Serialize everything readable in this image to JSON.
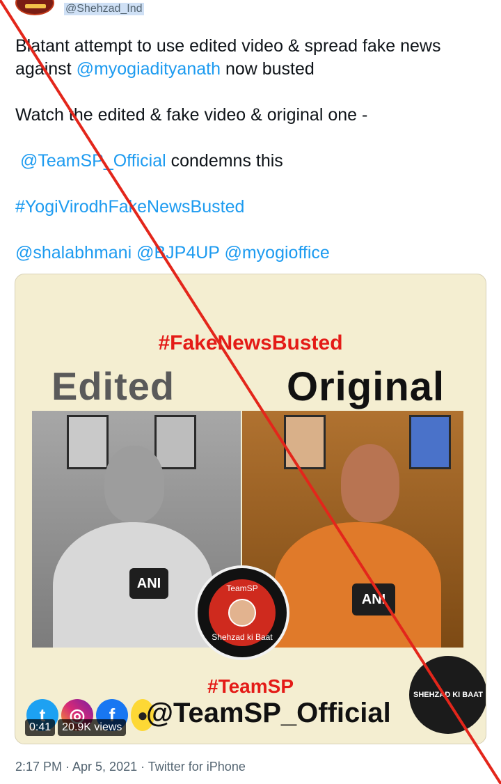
{
  "author": {
    "handle": "@Shehzad_Ind"
  },
  "tweet": {
    "line1_prefix": "Blatant attempt to use edited video & spread fake news against ",
    "mention_yogi": "@myogiadityanath",
    "line1_suffix": " now busted",
    "line2": "Watch the edited & fake video & original one -",
    "mention_teamsp": "@TeamSP_Official",
    "line3_suffix": " condemns this",
    "hashtag": "#YogiVirodhFakeNewsBusted",
    "mention_1": "@shalabhmani",
    "mention_2": "@BJP4UP",
    "mention_3": "@myogioffice"
  },
  "media": {
    "hashtag_top": "#FakeNewsBusted",
    "label_left": "Edited",
    "label_right": "Original",
    "mic_logo": "ANI",
    "badge_title": "TeamSP",
    "badge_subtitle": "Shehzad ki Baat",
    "hashtag_bottom": "#TeamSP",
    "handle_big": "@TeamSP_Official",
    "corner_logo_text": "SHEHZAD KI BAAT",
    "duration": "0:41",
    "views": "20.9K views",
    "social_icons": [
      "twitter-icon",
      "instagram-icon",
      "facebook-icon",
      "koo-icon"
    ]
  },
  "meta": {
    "text": "2:17 PM · Apr 5, 2021 · Twitter for iPhone"
  },
  "colors": {
    "link": "#1d9bf0",
    "red_text": "#e41b17",
    "strike": "#e3261b"
  }
}
